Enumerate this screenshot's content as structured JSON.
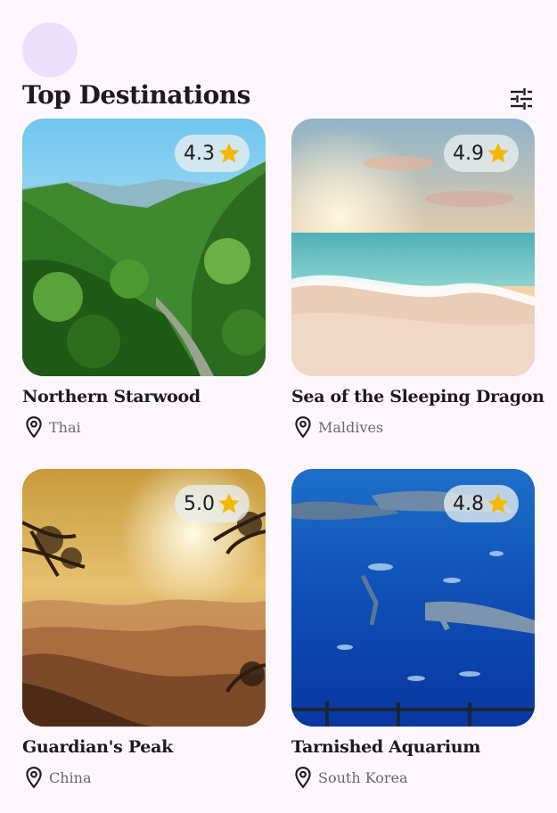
{
  "header": {
    "title": "Top Destinations",
    "filter_icon": "tune-icon"
  },
  "colors": {
    "background": "#fdf7fd",
    "avatar": "#ebe0fb",
    "star": "#f5b800",
    "text": "#1c1b1f",
    "location_text": "#6b6670"
  },
  "destinations": [
    {
      "name": "Northern Starwood",
      "location": "Thai",
      "rating": "4.3",
      "image": "forest-mountain-valley"
    },
    {
      "name": "Sea of the Sleeping Dragon",
      "location": "Maldives",
      "rating": "4.9",
      "image": "beach-sunset"
    },
    {
      "name": "Guardian's Peak",
      "location": "China",
      "rating": "5.0",
      "image": "misty-mountain-sunrise"
    },
    {
      "name": "Tarnished Aquarium",
      "location": "South Korea",
      "rating": "4.8",
      "image": "aquarium-whale-shark"
    }
  ]
}
